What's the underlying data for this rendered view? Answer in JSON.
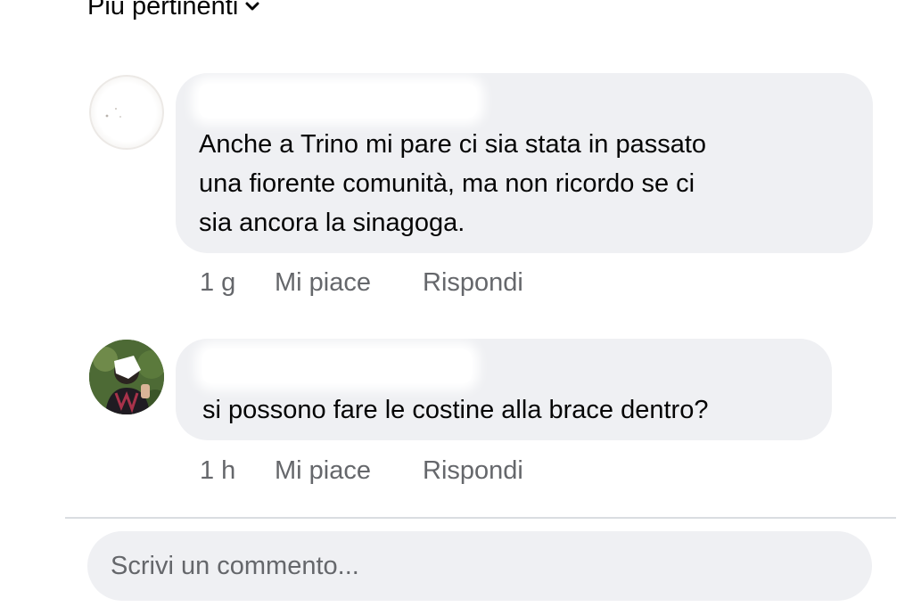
{
  "sort": {
    "label": "Più pertinenti",
    "icon": "chevron-down-icon"
  },
  "comments": [
    {
      "author": "",
      "text": "Anche a Trino mi pare ci sia stata in passato\nuna fiorente comunità, ma non ricordo se ci\nsia ancora la sinagoga.",
      "time": "1 g",
      "like_label": "Mi piace",
      "reply_label": "Rispondi"
    },
    {
      "author": "",
      "text": "si possono fare le costine alla brace dentro?",
      "time": "1 h",
      "like_label": "Mi piace",
      "reply_label": "Rispondi"
    }
  ],
  "composer": {
    "placeholder": "Scrivi un commento..."
  },
  "colors": {
    "bubble": "#eff0f3",
    "secondary_text": "#65676b",
    "primary_text": "#050505",
    "divider": "#dadde1"
  }
}
